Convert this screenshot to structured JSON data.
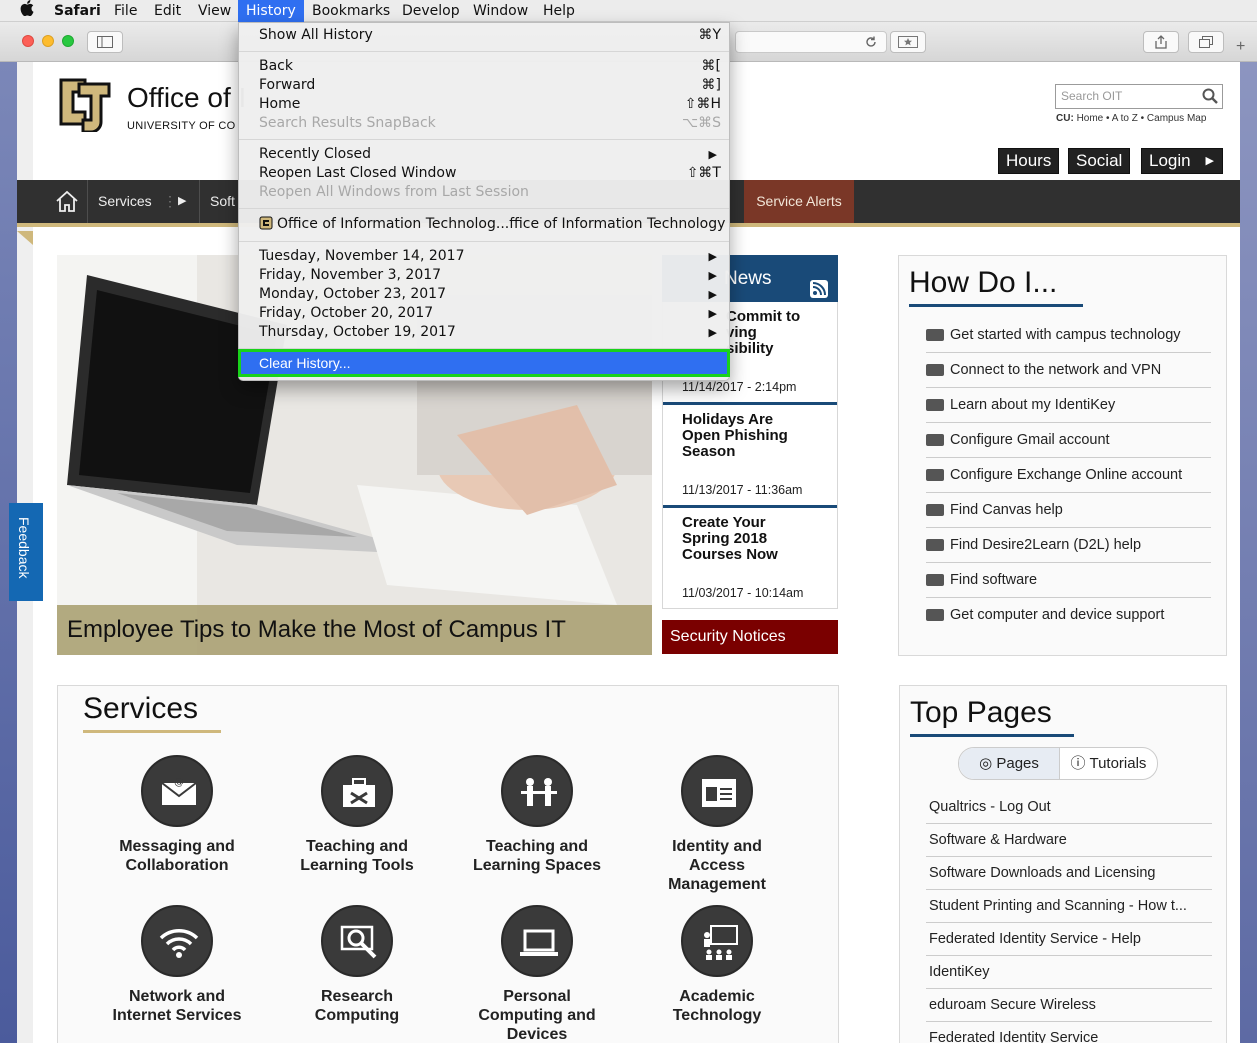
{
  "menubar": {
    "apple": "",
    "app": "Safari",
    "items": [
      "File",
      "Edit",
      "View",
      "History",
      "Bookmarks",
      "Develop",
      "Window",
      "Help"
    ]
  },
  "history_menu": {
    "show_all": {
      "label": "Show All History",
      "shortcut": "⌘Y"
    },
    "back": {
      "label": "Back",
      "shortcut": "⌘["
    },
    "forward": {
      "label": "Forward",
      "shortcut": "⌘]"
    },
    "home": {
      "label": "Home",
      "shortcut": "⇧⌘H"
    },
    "snapback": {
      "label": "Search Results SnapBack",
      "shortcut": "⌥⌘S"
    },
    "recently_closed": "Recently Closed",
    "reopen_last": {
      "label": "Reopen Last Closed Window",
      "shortcut": "⇧⌘T"
    },
    "reopen_all": "Reopen All Windows from Last Session",
    "recent_site": "Office of Information Technolog...ffice of Information Technology",
    "days": [
      "Tuesday, November 14, 2017",
      "Friday, November 3, 2017",
      "Monday, October 23, 2017",
      "Friday, October 20, 2017",
      "Thursday, October 19, 2017"
    ],
    "clear": "Clear History..."
  },
  "header": {
    "title": "Office of I",
    "subtitle": "UNIVERSITY OF CO",
    "search_placeholder": "Search OIT",
    "cu_prefix": "CU:",
    "cu_links": "Home • A to Z • Campus Map",
    "buttons": [
      "Hours",
      "Social",
      "Login"
    ]
  },
  "nav": {
    "services": "Services",
    "soft": "Soft",
    "alerts": "Service Alerts"
  },
  "hero": {
    "caption": "Employee Tips to Make the Most of Campus IT"
  },
  "news": {
    "heading": "News",
    "items": [
      {
        "title": "Commit to\nving\nsibility\n.",
        "date": "11/14/2017 - 2:14pm"
      },
      {
        "title": "Holidays Are\nOpen Phishing\nSeason",
        "date": "11/13/2017 - 11:36am"
      },
      {
        "title": "Create Your\nSpring 2018\nCourses Now",
        "date": "11/03/2017 - 10:14am"
      }
    ],
    "security": "Security Notices"
  },
  "how_do_i": {
    "title": "How Do I...",
    "items": [
      "Get started with campus technology",
      "Connect to the network and VPN",
      "Learn about my IdentiKey",
      "Configure Gmail account",
      "Configure Exchange Online account",
      "Find Canvas help",
      "Find Desire2Learn (D2L) help",
      "Find software",
      "Get computer and device support"
    ]
  },
  "services": {
    "title": "Services",
    "items": [
      {
        "label": "Messaging and\nCollaboration",
        "icon": "envelope-icon"
      },
      {
        "label": "Teaching and\nLearning Tools",
        "icon": "toolbox-icon"
      },
      {
        "label": "Teaching and\nLearning Spaces",
        "icon": "classroom-icon"
      },
      {
        "label": "Identity and\nAccess\nManagement",
        "icon": "id-card-icon"
      },
      {
        "label": "Network and\nInternet Services",
        "icon": "wifi-icon"
      },
      {
        "label": "Research\nComputing",
        "icon": "magnifier-icon"
      },
      {
        "label": "Personal\nComputing and\nDevices",
        "icon": "laptop-icon"
      },
      {
        "label": "Academic\nTechnology",
        "icon": "presentation-icon"
      }
    ]
  },
  "top_pages": {
    "title": "Top Pages",
    "tabs": [
      "Pages",
      "Tutorials"
    ],
    "items": [
      "Qualtrics - Log Out",
      "Software & Hardware",
      "Software Downloads and Licensing",
      "Student Printing and Scanning - How t...",
      "Federated Identity Service - Help",
      "IdentiKey",
      "eduroam Secure Wireless",
      "Federated Identity Service"
    ]
  },
  "feedback": "Feedback",
  "colors": {
    "menu_highlight": "#2f6ff1",
    "highlight_border": "#19d21b",
    "cu_gold": "#cfb87c",
    "cu_blue": "#194a78",
    "alert": "#7a3727",
    "security": "#7a0000"
  }
}
